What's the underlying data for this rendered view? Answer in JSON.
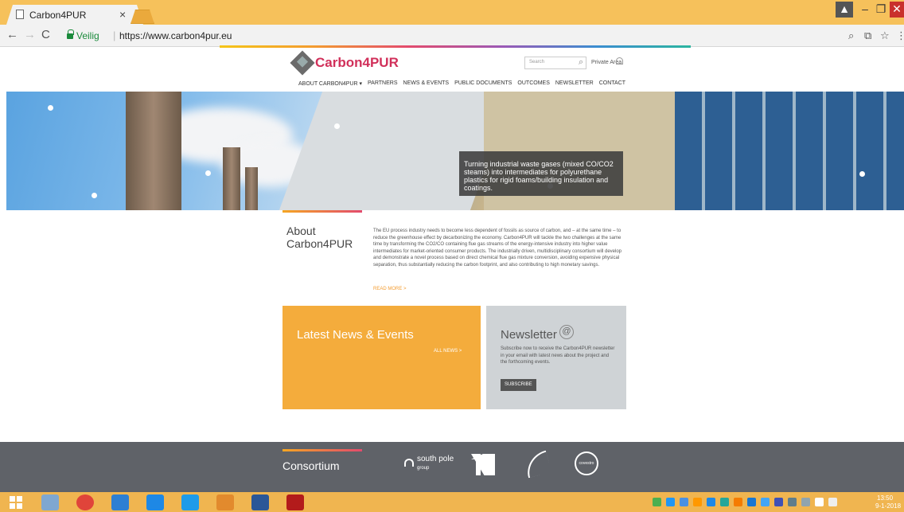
{
  "browser": {
    "tab_title": "Carbon4PUR",
    "tab_close": "×",
    "secure_label": "Veilig",
    "url_separator": "|",
    "url": "https://www.carbon4pur.eu",
    "back": "←",
    "forward": "→",
    "reload": "C",
    "zoom_icon": "⌕",
    "star_icon": "☆",
    "menu_icon": "⋮"
  },
  "site": {
    "logo_text": "Carbon4PUR",
    "search_placeholder": "Search",
    "private_area": "Private Area",
    "nav": [
      "ABOUT CARBON4PUR ▾",
      "PARTNERS",
      "NEWS & EVENTS",
      "PUBLIC DOCUMENTS",
      "OUTCOMES",
      "NEWSLETTER",
      "CONTACT"
    ],
    "hero_caption": "Turning industrial waste gases (mixed CO/CO2 steams) into intermediates for polyurethane plastics for rigid foams/building insulation and coatings.",
    "about": {
      "title": "About Carbon4PUR",
      "text": "The EU process industry needs to become less dependent of fossils as source of carbon, and – at the same time – to reduce the greenhouse effect by decarbonizing the economy. Carbon4PUR will tackle the two challenges at the same time by transforming the CO2/CO containing flue gas streams of the energy-intensive industry into higher value intermediates for market-oriented consumer products. The industrially driven, multidisciplinary consortium will develop and demonstrate a novel process based on direct chemical flue gas mixture conversion, avoiding expensive physical separation, thus substantially reducing the carbon footprint, and also contributing to high monetary savings.",
      "read_more": "READ MORE >"
    },
    "news": {
      "title": "Latest News & Events",
      "link": "ALL NEWS >"
    },
    "newsletter": {
      "title": "Newsletter",
      "at_icon": "@",
      "text": "Subscribe now to receive the Carbon4PUR newsletter in your email with latest news about the project and the forthcoming events.",
      "button": "SUBSCRIBE"
    },
    "consortium": {
      "title": "Consortium",
      "south_pole": "south pole",
      "south_pole_sub": "group",
      "covestro": "covestro",
      "pno": "PNO"
    }
  },
  "taskbar": {
    "time": "13:50",
    "date": "9-1-2018"
  }
}
